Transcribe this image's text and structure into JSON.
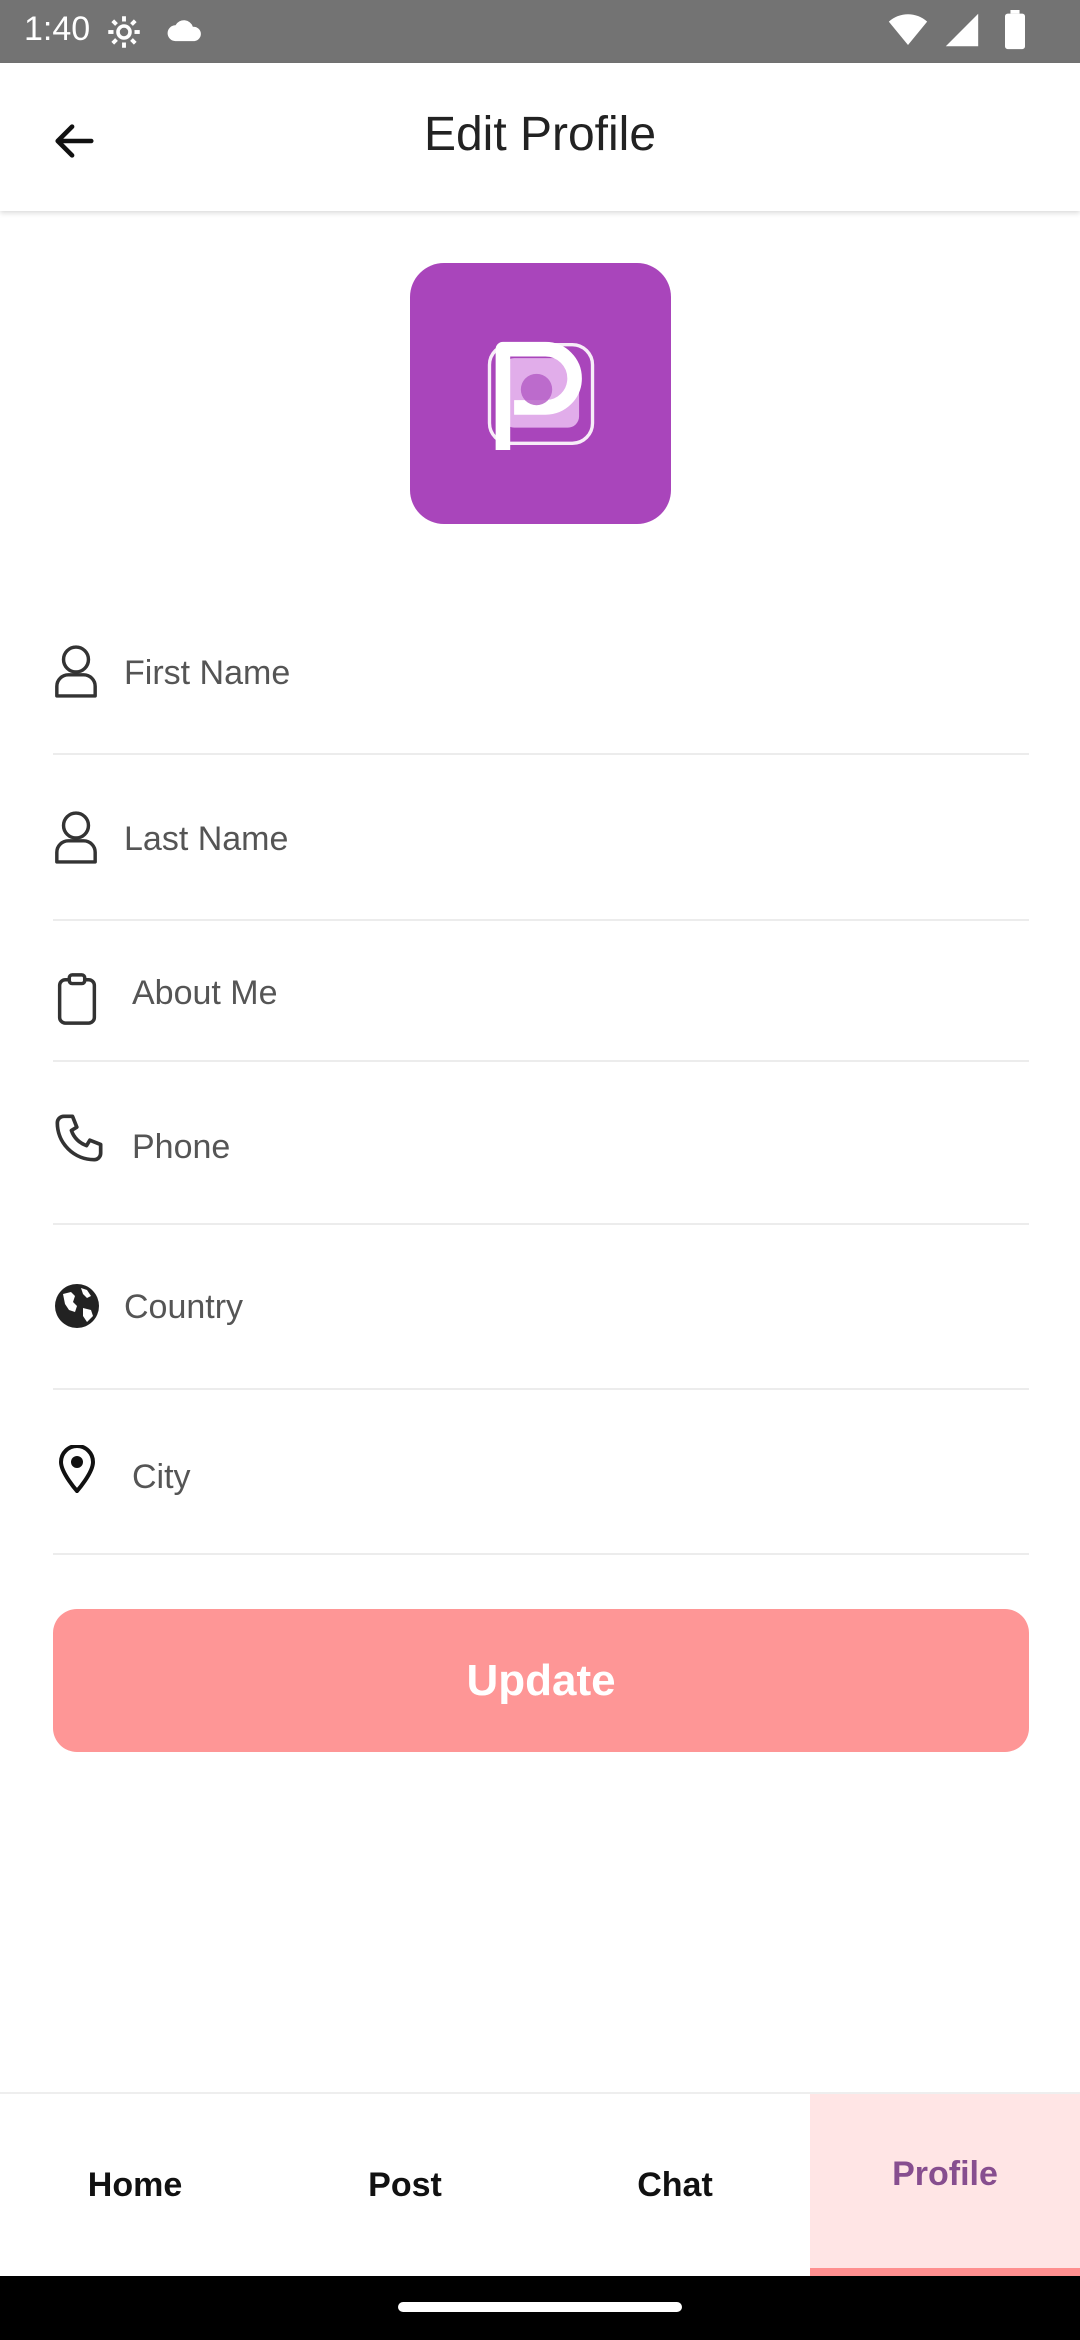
{
  "status_bar": {
    "time": "1:40"
  },
  "header": {
    "title": "Edit Profile"
  },
  "form": {
    "first_name": "First Name",
    "last_name": "Last Name",
    "about_me": "About Me",
    "phone": "Phone",
    "country": "Country",
    "city": "City"
  },
  "update_label": "Update",
  "nav": {
    "home": "Home",
    "post": "Post",
    "chat": "Chat",
    "profile": "Profile"
  },
  "colors": {
    "accent": "#a945bb",
    "button": "#fe9696",
    "nav_active_bg": "#ffe5e5",
    "nav_active_text": "#874e8f"
  }
}
